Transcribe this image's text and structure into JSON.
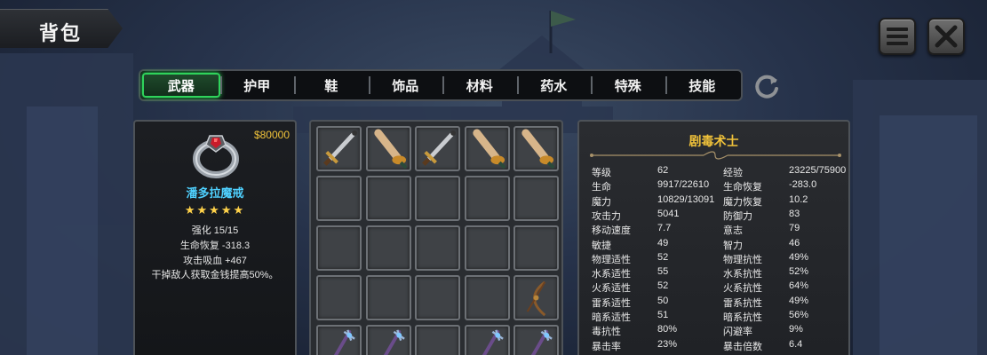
{
  "header": {
    "title": "背包"
  },
  "tabs": [
    {
      "label": "武器",
      "active": true
    },
    {
      "label": "护甲",
      "active": false
    },
    {
      "label": "鞋",
      "active": false
    },
    {
      "label": "饰品",
      "active": false
    },
    {
      "label": "材料",
      "active": false
    },
    {
      "label": "药水",
      "active": false
    },
    {
      "label": "特殊",
      "active": false
    },
    {
      "label": "技能",
      "active": false
    }
  ],
  "item": {
    "price": "$80000",
    "icon": "ring-icon",
    "name": "潘多拉魔戒",
    "stars": "★★★★★",
    "star_count": 5,
    "enhance": "强化 15/15",
    "stat1": "生命恢复  -318.3",
    "stat2": "攻击吸血  +467",
    "effect": "干掉敌人获取金钱提高50%。"
  },
  "inventory": {
    "slots": [
      "sword-icon",
      "wooden-sword-icon",
      "sword-icon",
      "wooden-sword-icon",
      "wooden-sword-icon",
      "",
      "",
      "",
      "",
      "",
      "",
      "",
      "",
      "",
      "",
      "",
      "",
      "",
      "",
      "bow-icon",
      "staff-icon",
      "staff-icon",
      "",
      "staff-icon",
      "staff-icon"
    ]
  },
  "stats": {
    "class_name": "剧毒术士",
    "rows": [
      [
        "等级",
        "62",
        "经验",
        "23225/75900"
      ],
      [
        "生命",
        "9917/22610",
        "生命恢复",
        "-283.0"
      ],
      [
        "魔力",
        "10829/13091",
        "魔力恢复",
        "10.2"
      ],
      [
        "攻击力",
        "5041",
        "防御力",
        "83"
      ],
      [
        "移动速度",
        "7.7",
        "意志",
        "79"
      ],
      [
        "敏捷",
        "49",
        "智力",
        "46"
      ],
      [
        "物理适性",
        "52",
        "物理抗性",
        "49%"
      ],
      [
        "水系适性",
        "55",
        "水系抗性",
        "52%"
      ],
      [
        "火系适性",
        "52",
        "火系抗性",
        "64%"
      ],
      [
        "雷系适性",
        "50",
        "雷系抗性",
        "49%"
      ],
      [
        "暗系适性",
        "51",
        "暗系抗性",
        "56%"
      ],
      [
        "毒抗性",
        "80%",
        "闪避率",
        "9%"
      ],
      [
        "暴击率",
        "23%",
        "暴击倍数",
        "6.4"
      ]
    ]
  },
  "colors": {
    "accent_green": "#2fd35b",
    "price_gold": "#f0c23a",
    "item_name_cyan": "#4fd1ff"
  }
}
